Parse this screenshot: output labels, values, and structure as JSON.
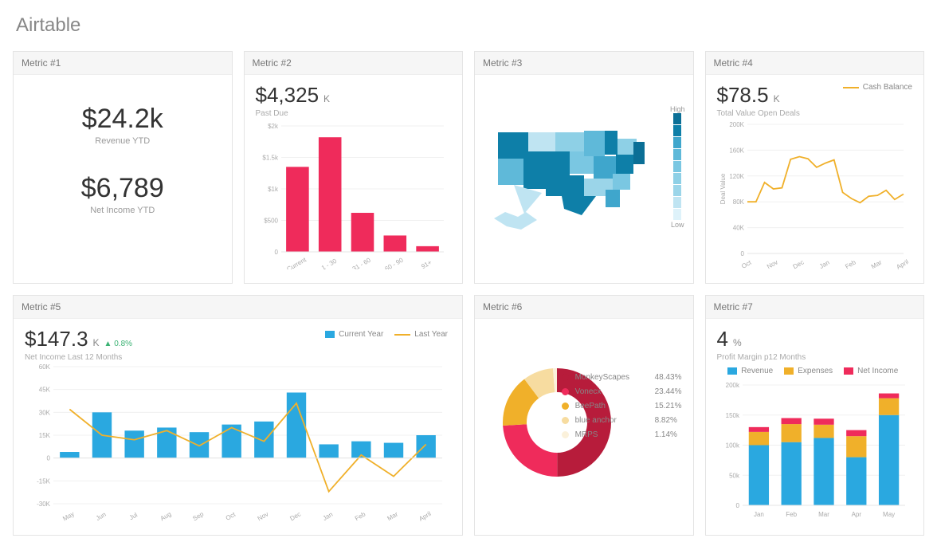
{
  "title": "Airtable",
  "cards": {
    "m1": {
      "title": "Metric #1",
      "val1": "$24.2k",
      "lab1": "Revenue YTD",
      "val2": "$6,789",
      "lab2": "Net Income YTD"
    },
    "m2": {
      "title": "Metric #2",
      "val": "$4,325",
      "unit": "K",
      "sub": "Past Due"
    },
    "m3": {
      "title": "Metric #3",
      "high": "High",
      "low": "Low"
    },
    "m4": {
      "title": "Metric #4",
      "val": "$78.5",
      "unit": "K",
      "sub": "Total Value Open Deals",
      "legend": "Cash Balance"
    },
    "m5": {
      "title": "Metric #5",
      "val": "$147.3",
      "unit": "K",
      "delta": "▲ 0.8%",
      "sub": "Net Income Last 12 Months",
      "legendA": "Current Year",
      "legendB": "Last Year"
    },
    "m6": {
      "title": "Metric #6"
    },
    "m7": {
      "title": "Metric #7",
      "val": "4",
      "unit": "%",
      "sub": "Profit Margin p12 Months",
      "legA": "Revenue",
      "legB": "Expenses",
      "legC": "Net Income"
    }
  },
  "chart_data": [
    {
      "id": "metric2",
      "type": "bar",
      "title": "Past Due",
      "categories": [
        "Current",
        "1 - 30",
        "31 - 60",
        "60 - 90",
        "91+"
      ],
      "values": [
        1350,
        1820,
        620,
        260,
        90
      ],
      "ylim": [
        0,
        2000
      ],
      "yticks": [
        0,
        500,
        1000,
        1500,
        2000
      ],
      "ytick_labels": [
        "0",
        "$500",
        "$1k",
        "$1.5k",
        "$2k"
      ],
      "color": "#ef2b5b"
    },
    {
      "id": "metric3",
      "type": "choropleth-map",
      "region": "USA",
      "scale": "Low → High",
      "note": "State-level shading; darker = higher. Exact per-state values not labeled."
    },
    {
      "id": "metric4",
      "type": "line",
      "title": "Total Value Open Deals",
      "series_name": "Cash Balance",
      "x": [
        "Oct",
        "Nov",
        "Dec",
        "Jan",
        "Feb",
        "Mar",
        "April"
      ],
      "values": [
        80,
        100,
        150,
        140,
        85,
        90,
        92
      ],
      "ylim": [
        0,
        200
      ],
      "yticks": [
        0,
        40,
        80,
        120,
        160,
        200
      ],
      "ytick_labels": [
        "0",
        "40K",
        "80K",
        "120K",
        "160K",
        "200K"
      ],
      "ylabel": "Deal Value",
      "color": "#f0b02a"
    },
    {
      "id": "metric5",
      "type": "bar+line",
      "title": "Net Income Last 12 Months",
      "categories": [
        "May",
        "Jun",
        "Jul",
        "Aug",
        "Sep",
        "Oct",
        "Nov",
        "Dec",
        "Jan",
        "Feb",
        "Mar",
        "April"
      ],
      "series": [
        {
          "name": "Current Year",
          "type": "bar",
          "color": "#2aa8e0",
          "values": [
            4,
            30,
            18,
            20,
            17,
            22,
            24,
            43,
            9,
            11,
            10,
            15
          ]
        },
        {
          "name": "Last Year",
          "type": "line",
          "color": "#f0b02a",
          "values": [
            32,
            15,
            12,
            18,
            8,
            20,
            11,
            36,
            -22,
            2,
            -12,
            9
          ]
        }
      ],
      "ylim": [
        -30,
        60
      ],
      "yticks": [
        -30,
        -15,
        0,
        15,
        30,
        45,
        60
      ],
      "ytick_labels": [
        "-30K",
        "-15K",
        "0",
        "15K",
        "30K",
        "45K",
        "60K"
      ]
    },
    {
      "id": "metric6",
      "type": "donut",
      "series": [
        {
          "name": "MonkeyScapes",
          "value": 48.43,
          "color": "#b71c3b"
        },
        {
          "name": "Vonecx",
          "value": 23.44,
          "color": "#ef2b5b"
        },
        {
          "name": "BeePath",
          "value": 15.21,
          "color": "#f0b02a"
        },
        {
          "name": "blue anchor",
          "value": 8.82,
          "color": "#f7dca0"
        },
        {
          "name": "MRPS",
          "value": 1.14,
          "color": "#fbf1db"
        }
      ]
    },
    {
      "id": "metric7",
      "type": "stacked-bar",
      "title": "Profit Margin p12 Months",
      "categories": [
        "Jan",
        "Feb",
        "Mar",
        "Apr",
        "May"
      ],
      "series": [
        {
          "name": "Revenue",
          "color": "#2aa8e0",
          "values": [
            100,
            105,
            112,
            80,
            150
          ]
        },
        {
          "name": "Expenses",
          "color": "#f0b02a",
          "values": [
            22,
            30,
            22,
            35,
            28
          ]
        },
        {
          "name": "Net Income",
          "color": "#ef2b5b",
          "values": [
            8,
            10,
            10,
            10,
            8
          ]
        }
      ],
      "ylim": [
        0,
        200
      ],
      "yticks": [
        0,
        50,
        100,
        150,
        200
      ],
      "ytick_labels": [
        "0",
        "50k",
        "100k",
        "150k",
        "200k"
      ]
    }
  ]
}
